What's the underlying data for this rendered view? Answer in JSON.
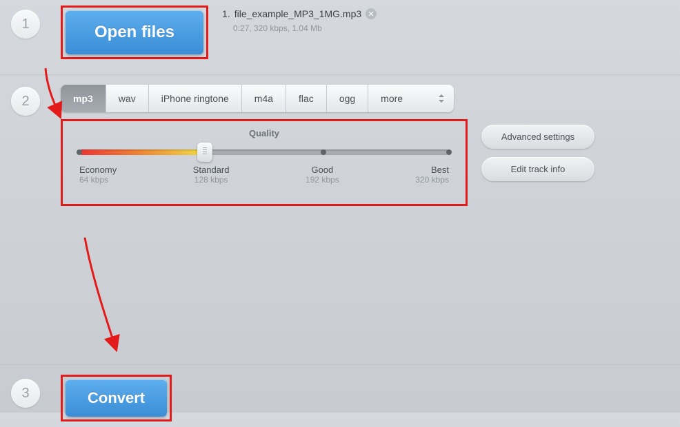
{
  "steps": {
    "one": "1",
    "two": "2",
    "three": "3"
  },
  "buttons": {
    "open_files": "Open files",
    "convert": "Convert",
    "advanced_settings": "Advanced settings",
    "edit_track_info": "Edit track info"
  },
  "file": {
    "index": "1.",
    "name": "file_example_MP3_1MG.mp3",
    "meta": "0:27, 320 kbps, 1.04 Mb"
  },
  "formats": {
    "mp3": "mp3",
    "wav": "wav",
    "ringtone": "iPhone ringtone",
    "m4a": "m4a",
    "flac": "flac",
    "ogg": "ogg",
    "more": "more"
  },
  "quality": {
    "title": "Quality",
    "economy": {
      "label": "Economy",
      "kbps": "64 kbps"
    },
    "standard": {
      "label": "Standard",
      "kbps": "128 kbps"
    },
    "good": {
      "label": "Good",
      "kbps": "192 kbps"
    },
    "best": {
      "label": "Best",
      "kbps": "320 kbps"
    }
  }
}
